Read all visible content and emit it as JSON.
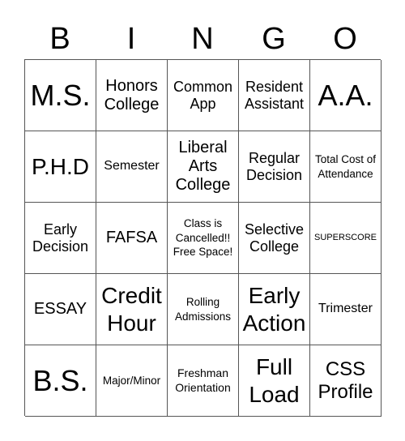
{
  "header": {
    "letters": [
      "B",
      "I",
      "N",
      "G",
      "O"
    ]
  },
  "board": {
    "rows": [
      [
        {
          "text": "M.S.",
          "size": "s-xl"
        },
        {
          "text": "Honors College",
          "size": "s-md"
        },
        {
          "text": "Common App",
          "size": "s-m"
        },
        {
          "text": "Resident Assistant",
          "size": "s-m"
        },
        {
          "text": "A.A.",
          "size": "s-xl"
        }
      ],
      [
        {
          "text": "P.H.D",
          "size": "s-lg"
        },
        {
          "text": "Semester",
          "size": "s-sm"
        },
        {
          "text": "Liberal Arts College",
          "size": "s-md"
        },
        {
          "text": "Regular Decision",
          "size": "s-m"
        },
        {
          "text": "Total Cost of Attendance",
          "size": "s-xxs"
        }
      ],
      [
        {
          "text": "Early Decision",
          "size": "s-m"
        },
        {
          "text": "FAFSA",
          "size": "s-md"
        },
        {
          "text": "Class is Cancelled!! Free Space!",
          "size": "s-xxs"
        },
        {
          "text": "Selective College",
          "size": "s-m"
        },
        {
          "text": "SUPERSCORE",
          "size": "s-tiny"
        }
      ],
      [
        {
          "text": "ESSAY",
          "size": "s-md"
        },
        {
          "text": "Credit Hour",
          "size": "s-lg"
        },
        {
          "text": "Rolling Admissions",
          "size": "s-xxs"
        },
        {
          "text": "Early Action",
          "size": "s-lg"
        },
        {
          "text": "Trimester",
          "size": "s-sm"
        }
      ],
      [
        {
          "text": "B.S.",
          "size": "s-xl"
        },
        {
          "text": "Major/Minor",
          "size": "s-xxs"
        },
        {
          "text": "Freshman Orientation",
          "size": "s-xs"
        },
        {
          "text": "Full Load",
          "size": "s-lg"
        },
        {
          "text": "CSS Profile",
          "size": "s-ml"
        }
      ]
    ]
  }
}
